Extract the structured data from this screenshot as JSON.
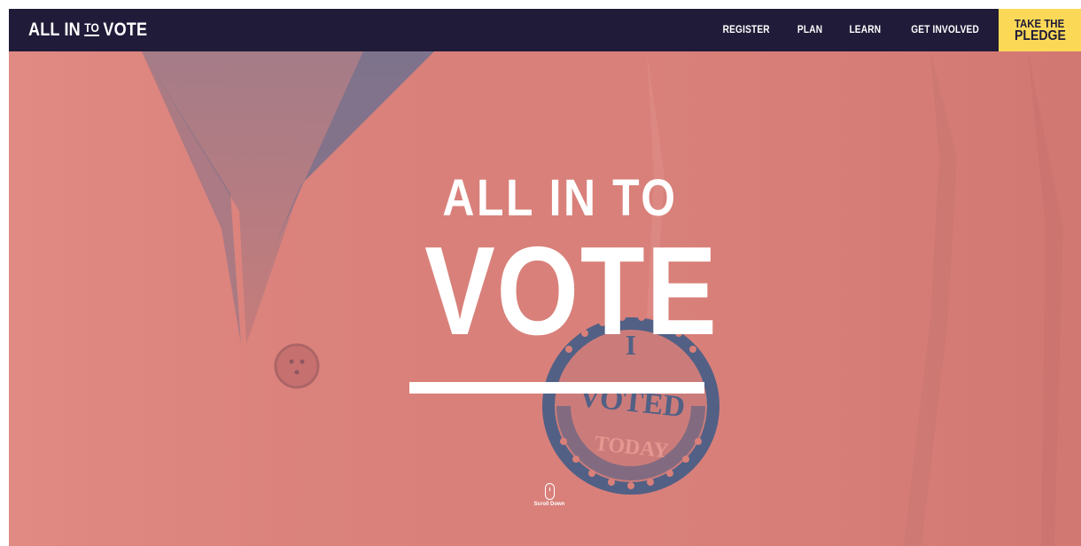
{
  "header": {
    "logo": {
      "part1": "ALL IN",
      "part2": "TO",
      "part3": "VOTE"
    },
    "nav": [
      {
        "label": "REGISTER"
      },
      {
        "label": "PLAN"
      },
      {
        "label": "LEARN"
      },
      {
        "label": "GET INVOLVED"
      }
    ],
    "cta": {
      "line1": "TAKE THE",
      "line2": "PLEDGE"
    }
  },
  "hero": {
    "title_line1": "ALL IN TO",
    "title_line2": "VOTE",
    "sticker": {
      "top": "I",
      "middle": "VOTED",
      "bottom": "TODAY"
    },
    "scroll_label": "Scroll Down",
    "scroll_icon": "mouse-icon"
  },
  "colors": {
    "navbar": "#1f1b38",
    "cta": "#fbd957",
    "hero_tint": "#d9807a",
    "sticker_blue": "#4b5f86"
  }
}
